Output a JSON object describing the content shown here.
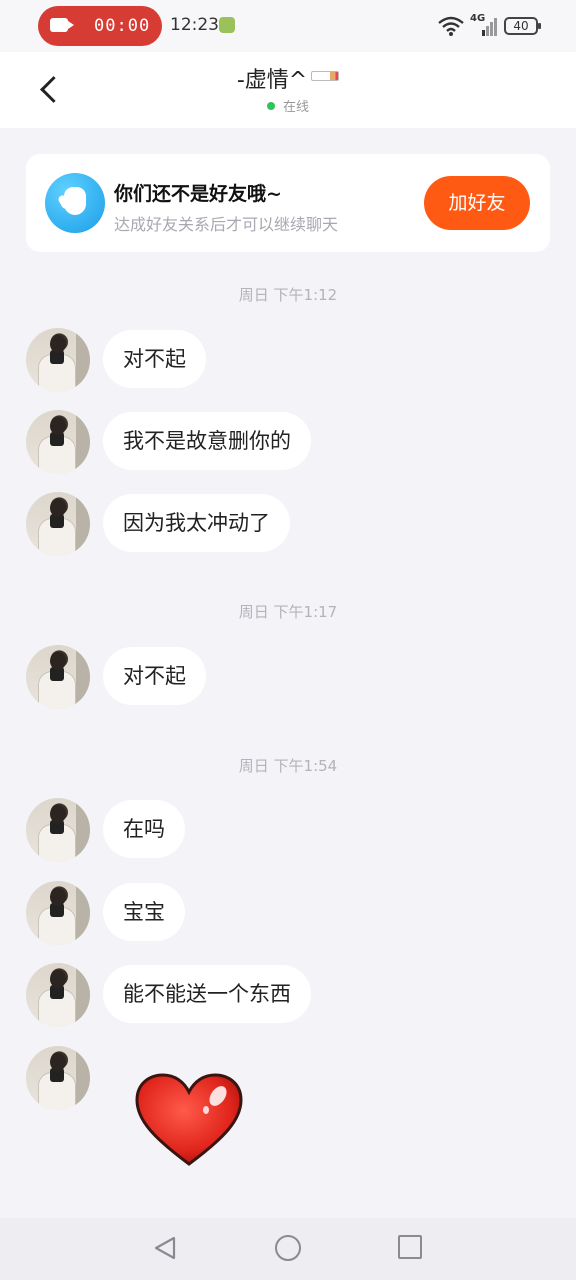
{
  "status_bar": {
    "recording_time": "00:00",
    "clock": "12:23",
    "network": "4G",
    "battery": "40"
  },
  "header": {
    "title": "-虚情^",
    "status": "在线"
  },
  "friend_card": {
    "title": "你们还不是好友哦~",
    "subtitle": "达成好友关系后才可以继续聊天",
    "button_label": "加好友"
  },
  "timestamps": [
    "周日 下午1:12",
    "周日 下午1:17",
    "周日 下午1:54"
  ],
  "messages": [
    "对不起",
    "我不是故意删你的",
    "因为我太冲动了",
    "对不起",
    "在吗",
    "宝宝",
    "能不能送一个东西"
  ],
  "icons": {
    "back": "back-arrow-icon",
    "hand": "hand-wave-icon",
    "heart": "heart-sticker",
    "nav_back": "triangle-back-icon",
    "nav_home": "circle-home-icon",
    "nav_recent": "square-recents-icon"
  },
  "colors": {
    "accent": "#ff5a14",
    "record": "#d63c33",
    "online": "#2fc35a",
    "background": "#f4f3f8"
  }
}
